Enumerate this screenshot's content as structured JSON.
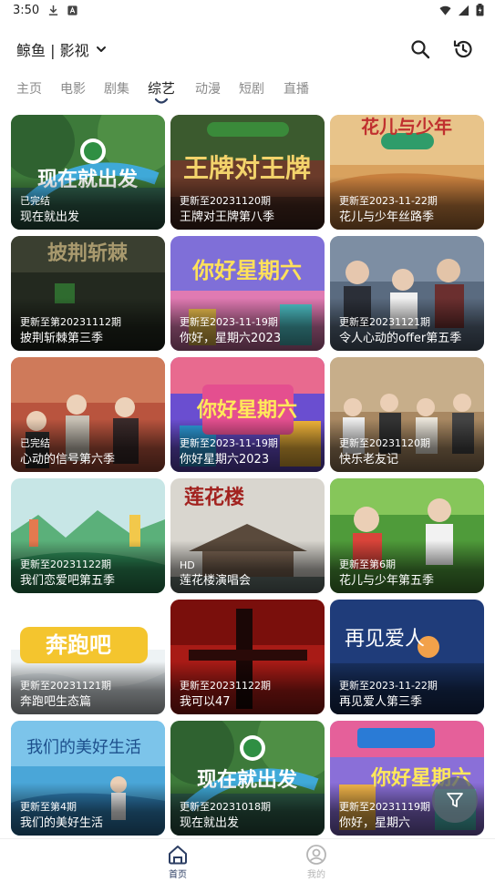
{
  "status_bar": {
    "time": "3:50",
    "left_icons": [
      "download-icon",
      "app-notification-icon"
    ],
    "right_icons": [
      "wifi-icon",
      "signal-icon",
      "battery-icon"
    ]
  },
  "header": {
    "source_title": "鲸鱼 | 影视",
    "source_dropdown_icon": "chevron-down-icon",
    "search_icon": "search-icon",
    "history_icon": "history-icon"
  },
  "tabs": [
    {
      "label": "主页",
      "active": false
    },
    {
      "label": "电影",
      "active": false
    },
    {
      "label": "剧集",
      "active": false
    },
    {
      "label": "综艺",
      "active": true
    },
    {
      "label": "动漫",
      "active": false
    },
    {
      "label": "短剧",
      "active": false
    },
    {
      "label": "直播",
      "active": false
    }
  ],
  "cards": [
    {
      "status": "已完结",
      "title": "现在就出发",
      "poster_text": "现在就出发"
    },
    {
      "status": "更新至20231120期",
      "title": "王牌对王牌第八季",
      "poster_text": "王牌对王牌"
    },
    {
      "status": "更新至2023-11-22期",
      "title": "花儿与少年丝路季",
      "poster_text": "花儿与少年"
    },
    {
      "status": "更新至第20231112期",
      "title": "披荆斩棘第三季",
      "poster_text": "披荆斩棘"
    },
    {
      "status": "更新至2023-11-19期",
      "title": "你好，星期六2023",
      "poster_text": "你好星期六"
    },
    {
      "status": "更新至20231121期",
      "title": "令人心动的offer第五季",
      "poster_text": ""
    },
    {
      "status": "已完结",
      "title": "心动的信号第六季",
      "poster_text": ""
    },
    {
      "status": "更新至2023-11-19期",
      "title": "你好星期六2023",
      "poster_text": "你好星期六"
    },
    {
      "status": "更新至20231120期",
      "title": "快乐老友记",
      "poster_text": ""
    },
    {
      "status": "更新至20231122期",
      "title": "我们恋爱吧第五季",
      "poster_text": ""
    },
    {
      "status": "HD",
      "title": "莲花楼演唱会",
      "poster_text": "莲花楼"
    },
    {
      "status": "更新至第6期",
      "title": "花儿与少年第五季",
      "poster_text": ""
    },
    {
      "status": "更新至20231121期",
      "title": "奔跑吧生态篇",
      "poster_text": "奔跑吧"
    },
    {
      "status": "更新至20231122期",
      "title": "我可以47",
      "poster_text": ""
    },
    {
      "status": "更新至2023-11-22期",
      "title": "再见爱人第三季",
      "poster_text": "再见爱人"
    },
    {
      "status": "更新至第4期",
      "title": "我们的美好生活",
      "poster_text": "我们的美好生活"
    },
    {
      "status": "更新至20231018期",
      "title": "现在就出发",
      "poster_text": "现在就出发"
    },
    {
      "status": "更新至20231119期",
      "title": "你好，星期六",
      "poster_text": "你好星期六"
    }
  ],
  "filter_button_icon": "filter-icon",
  "bottom_nav": [
    {
      "label": "首页",
      "icon": "home-icon",
      "active": true
    },
    {
      "label": "我的",
      "icon": "profile-icon",
      "active": false
    }
  ],
  "colors": {
    "accent": "#2c3e63",
    "inactive": "#b5b5b5",
    "tab_inactive": "#8a8a8a"
  }
}
